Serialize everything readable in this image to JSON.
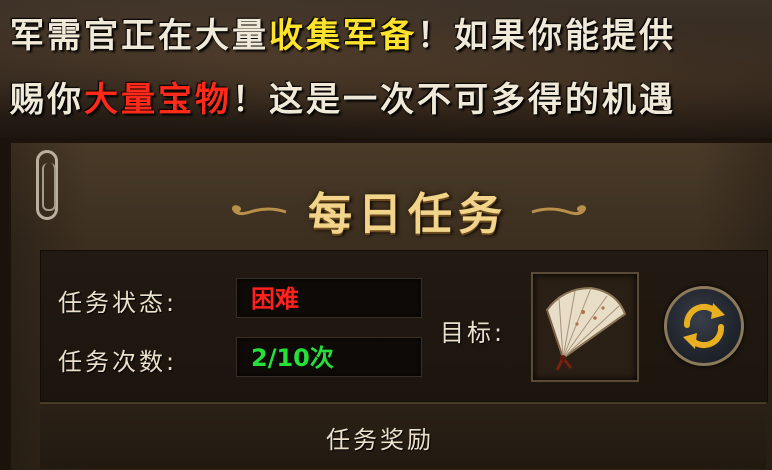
{
  "banner": {
    "line1": [
      {
        "text": "军需官正在大量",
        "color": "white"
      },
      {
        "text": "收集军备",
        "color": "yellow"
      },
      {
        "text": "！如果你能提供",
        "color": "white"
      }
    ],
    "line2": [
      {
        "text": "赐你",
        "color": "white"
      },
      {
        "text": "大量宝物",
        "color": "red"
      },
      {
        "text": "！这是一次不可多得的机遇",
        "color": "white"
      }
    ]
  },
  "panel": {
    "title": "每日任务",
    "status_label": "任务状态:",
    "status_value": "困难",
    "count_label": "任务次数:",
    "count_value": "2/10次",
    "target_label": "目标:",
    "target_item_icon": "folding-fan-icon",
    "refresh_icon": "refresh-icon",
    "reward_title": "任务奖励"
  },
  "colors": {
    "status_hard": "#ff2020",
    "count_ok": "#26e03a",
    "title_gold": "#f2d48a",
    "highlight_yellow": "#ffe22b",
    "highlight_red": "#ff2a1a"
  }
}
